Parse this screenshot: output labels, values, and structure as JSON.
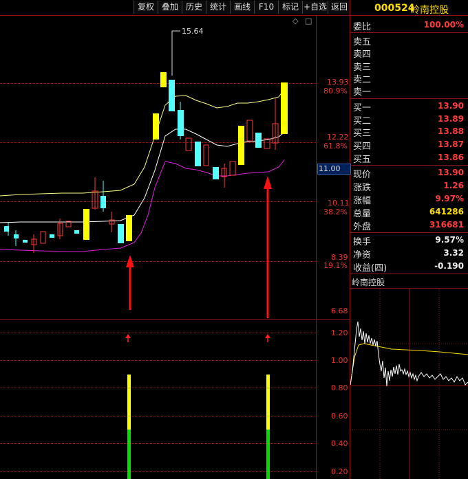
{
  "toolbar": {
    "buttons": [
      "复权",
      "叠加",
      "历史",
      "统计",
      "画线",
      "F10",
      "标记",
      "+自选",
      "返回"
    ],
    "marker": "◇",
    "marker_close": "□"
  },
  "main_chart": {
    "price_labels": [
      "13.93",
      "12.22",
      "10.11",
      "8.39",
      "6.68"
    ],
    "pct_labels": [
      "80.9%",
      "61.8%",
      "38.2%",
      "19.1%"
    ],
    "current_price_tag": "11.00",
    "peak_label": "15.64"
  },
  "oscillator": {
    "labels": [
      "1.20",
      "1.00",
      "0.80",
      "0.60",
      "0.40",
      "0.20"
    ]
  },
  "quote": {
    "code": "000524",
    "name": "岭南控股",
    "weibi_label": "委比",
    "weibi_value": "100.00%",
    "asks": [
      {
        "label": "卖五",
        "price": ""
      },
      {
        "label": "卖四",
        "price": ""
      },
      {
        "label": "卖三",
        "price": ""
      },
      {
        "label": "卖二",
        "price": ""
      },
      {
        "label": "卖一",
        "price": ""
      }
    ],
    "bids": [
      {
        "label": "买一",
        "price": "13.90"
      },
      {
        "label": "买二",
        "price": "13.89"
      },
      {
        "label": "买三",
        "price": "13.88"
      },
      {
        "label": "买四",
        "price": "13.87"
      },
      {
        "label": "买五",
        "price": "13.86"
      }
    ],
    "stats": [
      {
        "label": "现价",
        "value": "13.90",
        "color": "#ff3b3b"
      },
      {
        "label": "涨跌",
        "value": "1.26",
        "color": "#ff3b3b"
      },
      {
        "label": "涨幅",
        "value": "9.97%",
        "color": "#ff3b3b"
      },
      {
        "label": "总量",
        "value": "641286",
        "color": "#ffde00"
      },
      {
        "label": "外盘",
        "value": "316681",
        "color": "#ff3b3b"
      }
    ],
    "stats2": [
      {
        "label": "换手",
        "value": "9.57%",
        "color": "#eeeeee"
      },
      {
        "label": "净资",
        "value": "3.32",
        "color": "#eeeeee"
      },
      {
        "label": "收益(四)",
        "value": "-0.190",
        "color": "#eeeeee"
      }
    ],
    "intraday_title": "岭南控股"
  },
  "colors": {
    "up": "#ff3b3b",
    "down_candle": "#54ffff",
    "limit_up": "#ffff00",
    "frame": "#8c1414",
    "signal_green": "#00dd00"
  }
}
